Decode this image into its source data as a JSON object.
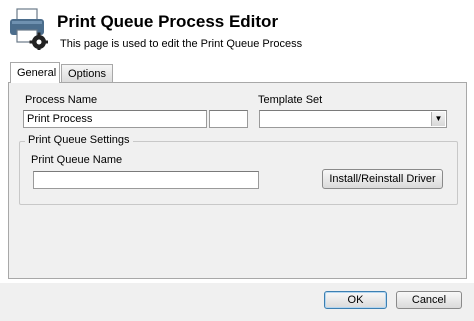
{
  "header": {
    "title": "Print Queue Process Editor",
    "subtitle": "This page is used to edit the Print Queue Process",
    "icon": "printer-gear-icon"
  },
  "tabs": [
    {
      "label": "General",
      "active": true
    },
    {
      "label": "Options",
      "active": false
    }
  ],
  "general": {
    "process_name_label": "Process Name",
    "process_name_value": "Print Process",
    "process_extra_1": "",
    "process_extra_2": "",
    "template_set_label": "Template Set",
    "template_set_value": "",
    "settings_group_label": "Print Queue Settings",
    "queue_name_label": "Print Queue Name",
    "queue_name_value": "",
    "install_button": "Install/Reinstall Driver"
  },
  "footer": {
    "ok_label": "OK",
    "cancel_label": "Cancel"
  },
  "colors": {
    "panel_bg": "#f0f0f0",
    "default_button_border": "#3c7fb1"
  }
}
